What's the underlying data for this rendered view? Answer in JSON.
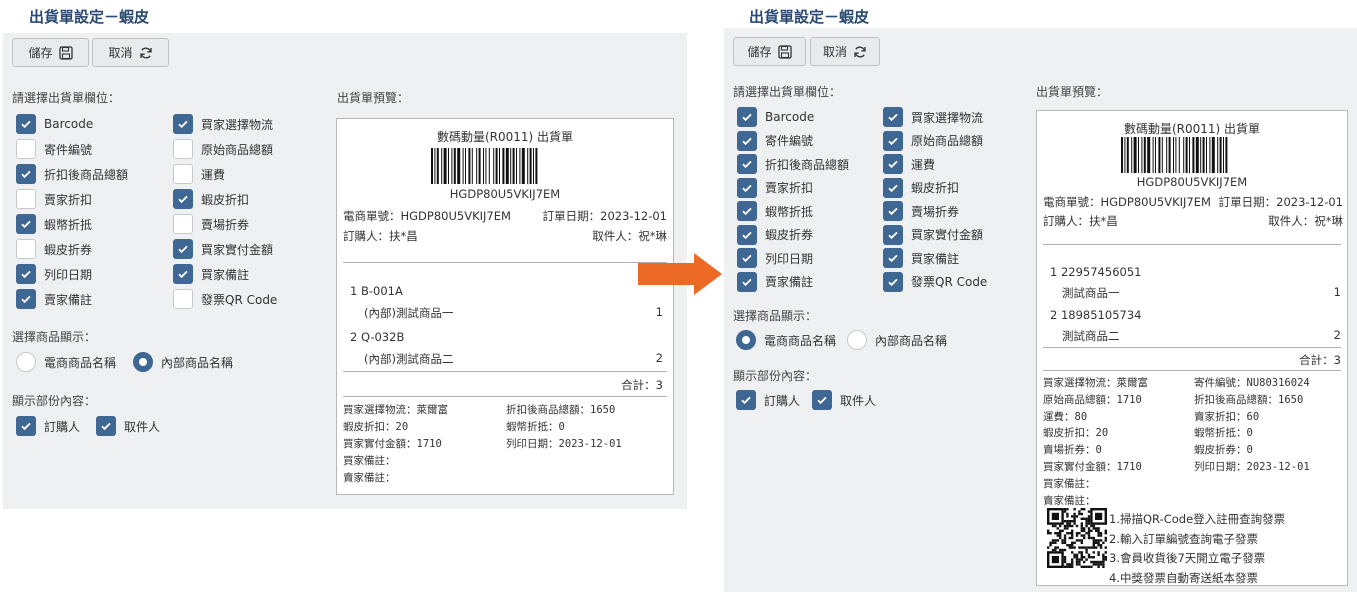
{
  "left": {
    "title": "出貨單設定－蝦皮",
    "save_label": "儲存",
    "cancel_label": "取消",
    "fields_label": "請選擇出貨單欄位：",
    "fields": [
      {
        "label": "Barcode",
        "checked": true
      },
      {
        "label": "買家選擇物流",
        "checked": true
      },
      {
        "label": "寄件編號",
        "checked": false
      },
      {
        "label": "原始商品總額",
        "checked": false
      },
      {
        "label": "折扣後商品總額",
        "checked": true
      },
      {
        "label": "運費",
        "checked": false
      },
      {
        "label": "賣家折扣",
        "checked": false
      },
      {
        "label": "蝦皮折扣",
        "checked": true
      },
      {
        "label": "蝦幣折抵",
        "checked": true
      },
      {
        "label": "賣場折券",
        "checked": false
      },
      {
        "label": "蝦皮折券",
        "checked": false
      },
      {
        "label": "買家實付金額",
        "checked": true
      },
      {
        "label": "列印日期",
        "checked": true
      },
      {
        "label": "買家備註",
        "checked": true
      },
      {
        "label": "賣家備註",
        "checked": true
      },
      {
        "label": "發票QR Code",
        "checked": false
      }
    ],
    "product_label": "選擇商品顯示：",
    "product_options": [
      {
        "label": "電商商品名稱",
        "selected": false
      },
      {
        "label": "內部商品名稱",
        "selected": true
      }
    ],
    "partial_label": "顯示部份內容：",
    "partial_options": [
      {
        "label": "訂購人",
        "checked": true
      },
      {
        "label": "取件人",
        "checked": true
      }
    ],
    "preview_label": "出貨單預覽：",
    "preview": {
      "header": "數碼動量(R0011) 出貨單",
      "barcode_text": "HGDP80U5VKIJ7EM",
      "order_no": "電商單號：HGDP80U5VKIJ7EM",
      "order_date": "訂單日期：2023-12-01",
      "buyer": "訂購人：扶*昌",
      "receiver": "取件人：祝*琳",
      "items": [
        {
          "code": "1  B-001A",
          "name": "(內部)測試商品一",
          "qty": "1"
        },
        {
          "code": "2  Q-032B",
          "name": "(內部)測試商品二",
          "qty": "2"
        }
      ],
      "total": "合計：3",
      "info": [
        [
          "買家選擇物流：萊爾富",
          "折扣後商品總額：1650"
        ],
        [
          "蝦皮折扣：20",
          "蝦幣折抵：0"
        ],
        [
          "買家實付金額：1710",
          "列印日期：2023-12-01"
        ],
        [
          "買家備註：",
          ""
        ],
        [
          "賣家備註：",
          ""
        ]
      ]
    }
  },
  "right": {
    "title": "出貨單設定－蝦皮",
    "save_label": "儲存",
    "cancel_label": "取消",
    "fields_label": "請選擇出貨單欄位：",
    "fields": [
      {
        "label": "Barcode",
        "checked": true
      },
      {
        "label": "買家選擇物流",
        "checked": true
      },
      {
        "label": "寄件編號",
        "checked": true
      },
      {
        "label": "原始商品總額",
        "checked": true
      },
      {
        "label": "折扣後商品總額",
        "checked": true
      },
      {
        "label": "運費",
        "checked": true
      },
      {
        "label": "賣家折扣",
        "checked": true
      },
      {
        "label": "蝦皮折扣",
        "checked": true
      },
      {
        "label": "蝦幣折抵",
        "checked": true
      },
      {
        "label": "賣場折券",
        "checked": true
      },
      {
        "label": "蝦皮折券",
        "checked": true
      },
      {
        "label": "買家實付金額",
        "checked": true
      },
      {
        "label": "列印日期",
        "checked": true
      },
      {
        "label": "買家備註",
        "checked": true
      },
      {
        "label": "賣家備註",
        "checked": true
      },
      {
        "label": "發票QR Code",
        "checked": true
      }
    ],
    "product_label": "選擇商品顯示：",
    "product_options": [
      {
        "label": "電商商品名稱",
        "selected": true
      },
      {
        "label": "內部商品名稱",
        "selected": false
      }
    ],
    "partial_label": "顯示部份內容：",
    "partial_options": [
      {
        "label": "訂購人",
        "checked": true
      },
      {
        "label": "取件人",
        "checked": true
      }
    ],
    "preview_label": "出貨單預覽：",
    "preview": {
      "header": "數碼動量(R0011) 出貨單",
      "barcode_text": "HGDP80U5VKIJ7EM",
      "order_no": "電商單號：HGDP80U5VKIJ7EM",
      "order_date": "訂單日期：2023-12-01",
      "buyer": "訂購人：扶*昌",
      "receiver": "取件人：祝*琳",
      "items": [
        {
          "code": "1  22957456051",
          "name": "測試商品一",
          "qty": "1"
        },
        {
          "code": "2  18985105734",
          "name": "測試商品二",
          "qty": "2"
        }
      ],
      "total": "合計：3",
      "info": [
        [
          "買家選擇物流：萊爾富",
          "寄件編號：NU80316024"
        ],
        [
          "原始商品總額：1710",
          "折扣後商品總額：1650"
        ],
        [
          "運費：80",
          "賣家折扣：60"
        ],
        [
          "蝦皮折扣：20",
          "蝦幣折抵：0"
        ],
        [
          "賣場折券：0",
          "蝦皮折券：0"
        ],
        [
          "買家實付金額：1710",
          "列印日期：2023-12-01"
        ],
        [
          "買家備註：",
          ""
        ],
        [
          "賣家備註：",
          ""
        ]
      ],
      "invoice_lines": [
        "1.掃描QR-Code登入註冊查詢發票",
        "2.輸入訂單編號查詢電子發票",
        "3.會員收貨後7天開立電子發票",
        "4.中獎發票自動寄送紙本發票"
      ]
    }
  }
}
